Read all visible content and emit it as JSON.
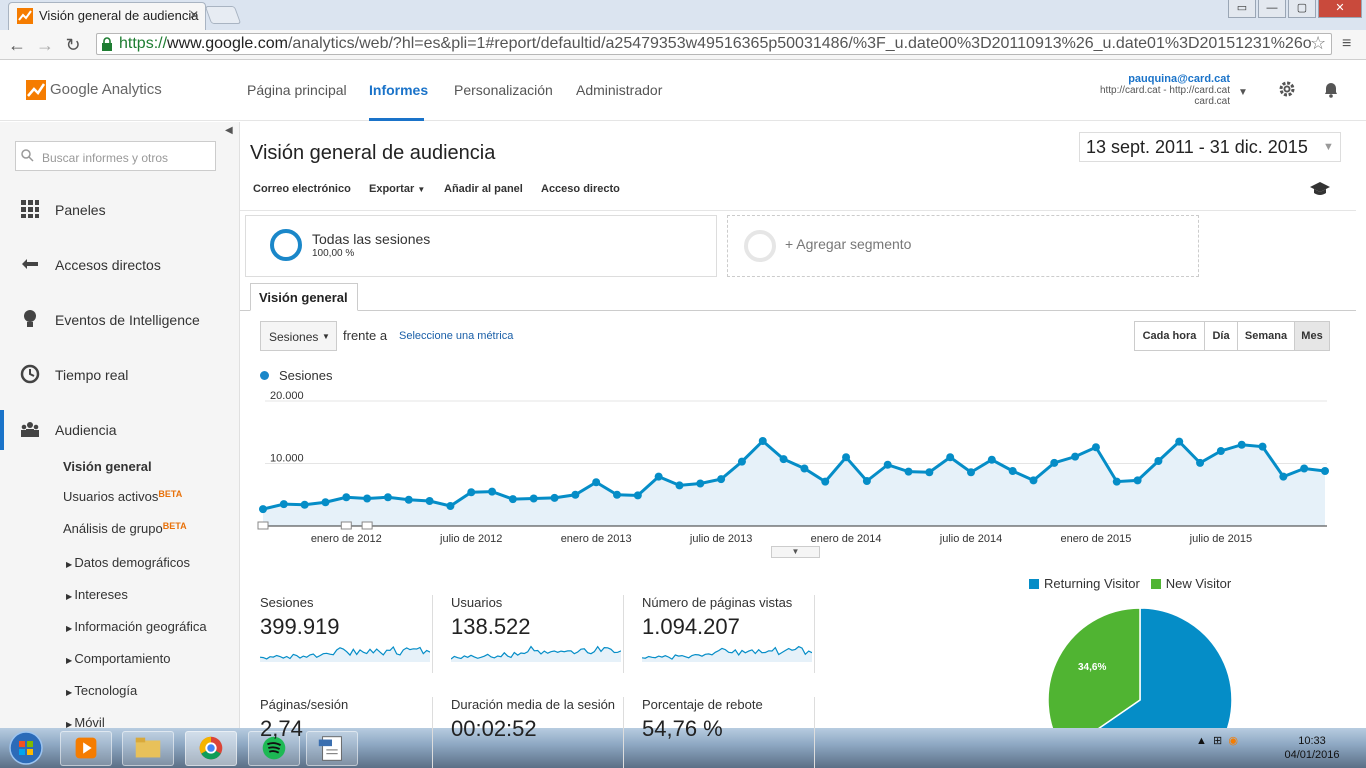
{
  "browser": {
    "tab_title": "Visión general de audiencia",
    "url_scheme": "https://",
    "url_host": "www.google.com",
    "url_path": "/analytics/web/?hl=es&pli=1#report/defaultid/a25479353w49516365p50031486/%3F_u.date00%3D20110913%26_u.date01%3D20151231%26o"
  },
  "ga": {
    "product": "Google Analytics",
    "nav": [
      "Página principal",
      "Informes",
      "Personalización",
      "Administrador"
    ],
    "account_email": "pauquina@card.cat",
    "account_property": "http://card.cat - http://card.cat",
    "account_view": "card.cat"
  },
  "sidebar": {
    "search_placeholder": "Buscar informes y otros",
    "items": [
      "Paneles",
      "Accesos directos",
      "Eventos de Intelligence",
      "Tiempo real",
      "Audiencia"
    ],
    "sub_items": [
      "Visión general",
      "Usuarios activos",
      "Análisis de grupo"
    ],
    "beta": "BETA",
    "sub2_items": [
      "Datos demográficos",
      "Intereses",
      "Información geográfica",
      "Comportamiento",
      "Tecnología",
      "Móvil"
    ]
  },
  "report": {
    "title": "Visión general de audiencia",
    "date_range": "13 sept. 2011 - 31 dic. 2015",
    "actions": [
      "Correo electrónico",
      "Exportar",
      "Añadir al panel",
      "Acceso directo"
    ],
    "segment_name": "Todas las sesiones",
    "segment_pct": "100,00 %",
    "add_segment": "+ Agregar segmento",
    "tab": "Visión general",
    "metric": "Sesiones",
    "vs": "frente a",
    "select_metric": "Seleccione una métrica",
    "granularity": [
      "Cada hora",
      "Día",
      "Semana",
      "Mes"
    ],
    "granularity_selected": "Mes"
  },
  "chart_data": {
    "type": "area",
    "legend": [
      "Sesiones"
    ],
    "y_ticks": [
      "20.000",
      "10.000"
    ],
    "ylim": [
      0,
      20000
    ],
    "x_tick_labels": [
      "enero de 2012",
      "julio de 2012",
      "enero de 2013",
      "julio de 2013",
      "enero de 2014",
      "julio de 2014",
      "enero de 2015",
      "julio de 2015"
    ],
    "x": [
      "2011-09",
      "2011-10",
      "2011-11",
      "2011-12",
      "2012-01",
      "2012-02",
      "2012-03",
      "2012-04",
      "2012-05",
      "2012-06",
      "2012-07",
      "2012-08",
      "2012-09",
      "2012-10",
      "2012-11",
      "2012-12",
      "2013-01",
      "2013-02",
      "2013-03",
      "2013-04",
      "2013-05",
      "2013-06",
      "2013-07",
      "2013-08",
      "2013-09",
      "2013-10",
      "2013-11",
      "2013-12",
      "2014-01",
      "2014-02",
      "2014-03",
      "2014-04",
      "2014-05",
      "2014-06",
      "2014-07",
      "2014-08",
      "2014-09",
      "2014-10",
      "2014-11",
      "2014-12",
      "2015-01",
      "2015-02",
      "2015-03",
      "2015-04",
      "2015-05",
      "2015-06",
      "2015-07",
      "2015-08",
      "2015-09",
      "2015-10",
      "2015-11",
      "2015-12"
    ],
    "series": [
      {
        "name": "Sesiones",
        "values": [
          2700,
          3500,
          3400,
          3800,
          4600,
          4400,
          4600,
          4200,
          4000,
          3200,
          5400,
          5500,
          4300,
          4400,
          4500,
          5000,
          7000,
          5000,
          4900,
          7900,
          6500,
          6800,
          7500,
          10300,
          13600,
          10700,
          9200,
          7100,
          11000,
          7200,
          9800,
          8700,
          8600,
          11000,
          8600,
          10600,
          8800,
          7300,
          10100,
          11100,
          12600,
          7100,
          7300,
          10400,
          13500,
          10100,
          12000,
          13000,
          12700,
          7900,
          9200,
          8800
        ]
      }
    ],
    "annotations": [
      {
        "x": "2011-09",
        "label": ""
      },
      {
        "x": "2012-01",
        "label": ""
      },
      {
        "x": "2012-02",
        "label": ""
      }
    ],
    "kpis": [
      {
        "label": "Sesiones",
        "value": "399.919"
      },
      {
        "label": "Usuarios",
        "value": "138.522"
      },
      {
        "label": "Número de páginas vistas",
        "value": "1.094.207"
      },
      {
        "label": "Páginas/sesión",
        "value": "2,74"
      },
      {
        "label": "Duración media de la sesión",
        "value": "00:02:52"
      },
      {
        "label": "Porcentaje de rebote",
        "value": "54,76 %"
      }
    ],
    "pie": {
      "type": "pie",
      "slices": [
        {
          "name": "Returning Visitor",
          "value": 65.4,
          "color": "#058dc7"
        },
        {
          "name": "New Visitor",
          "value": 34.6,
          "color": "#50b432"
        }
      ],
      "visible_label": "34,6%"
    }
  },
  "taskbar": {
    "time": "10:33",
    "date": "04/01/2016"
  },
  "colors": {
    "accent": "#1a73c9",
    "series": "#058dc7",
    "new_visitor": "#50b432",
    "ga_orange": "#f57c00"
  }
}
